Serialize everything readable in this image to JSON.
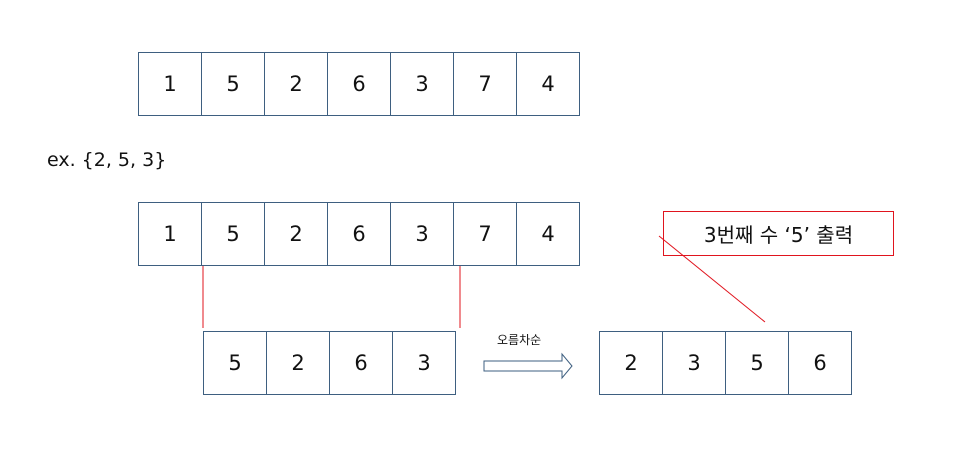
{
  "array": {
    "values": [
      "1",
      "5",
      "2",
      "6",
      "3",
      "7",
      "4"
    ]
  },
  "example": {
    "label": "ex. {2, 5, 3}"
  },
  "subarray": {
    "values": [
      "5",
      "2",
      "6",
      "3"
    ]
  },
  "sort": {
    "label": "오름차순"
  },
  "sorted": {
    "values": [
      "2",
      "3",
      "5",
      "6"
    ]
  },
  "result": {
    "label": "3번째 수 ‘5’ 출력"
  },
  "colors": {
    "cell_border": "#3e5f80",
    "highlight_line": "#e0141e",
    "arrow_outline": "#3e5f80"
  }
}
